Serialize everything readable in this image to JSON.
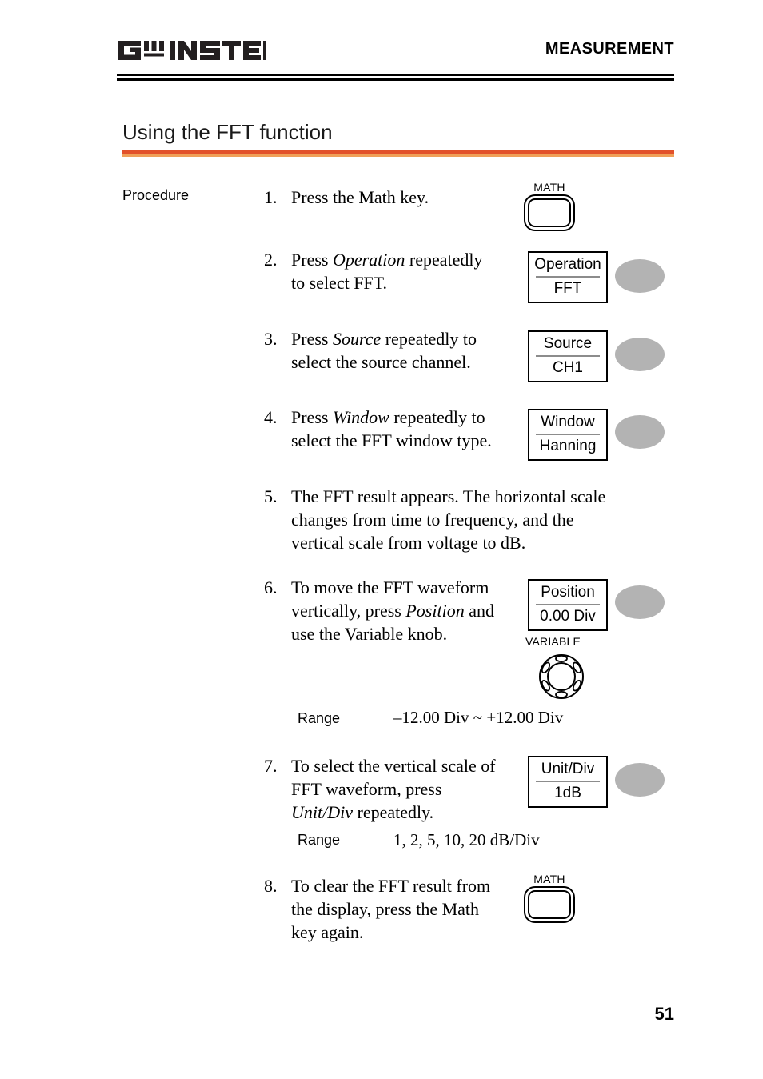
{
  "header": {
    "logo_text": "GW INSTEK",
    "chapter_title": "MEASUREMENT"
  },
  "section": {
    "title": "Using the FFT function"
  },
  "procedure": {
    "label": "Procedure"
  },
  "steps": [
    {
      "number": "1.",
      "text_html": "Press the Math key."
    },
    {
      "number": "2.",
      "text_html": "Press <i>Operation</i> repeatedly<br>to select FFT."
    },
    {
      "number": "3.",
      "text_html": "Press <i>Source</i> repeatedly to<br>select the source channel."
    },
    {
      "number": "4.",
      "text_html": "Press <i>Window</i> repeatedly to<br>select the FFT window type."
    },
    {
      "number": "5.",
      "text_html": "The FFT result appears. The horizontal scale<br>changes from time to frequency, and the<br>vertical scale from voltage to dB."
    },
    {
      "number": "6.",
      "text_html": "To move the FFT waveform<br>vertically, press <i>Position</i> and<br>use the Variable knob."
    },
    {
      "number": "7.",
      "text_html": "To select the vertical scale of<br>FFT waveform, press<br><i>Unit/Div</i> repeatedly."
    },
    {
      "number": "8.",
      "text_html": "To clear the FFT result from<br>the display, press the Math<br>key again."
    }
  ],
  "softkeys": [
    {
      "name": "operation",
      "top_label": "Operation",
      "bottom_value": "FFT"
    },
    {
      "name": "source",
      "top_label": "Source",
      "bottom_value": "CH1"
    },
    {
      "name": "window",
      "top_label": "Window",
      "bottom_value": "Hanning"
    },
    {
      "name": "position",
      "top_label": "Position",
      "bottom_value": "0.00 Div"
    },
    {
      "name": "unit-div",
      "top_label": "Unit/Div",
      "bottom_value": "1dB"
    }
  ],
  "hardkeys": {
    "math_label": "MATH"
  },
  "knob": {
    "label": "VARIABLE"
  },
  "ranges": [
    {
      "label": "Range",
      "value": "–12.00 Div ~ +12.00 Div"
    },
    {
      "label": "Range",
      "value": "1, 2, 5, 10, 20 dB/Div"
    }
  ],
  "footer": {
    "page_number": "51"
  },
  "colors": {
    "rule_dark_orange": "#e2512a",
    "rule_light_orange": "#f0a058",
    "softkey_ellipse_gray": "#b3b3b3",
    "softkey_divider_gray": "#8c8c8c"
  }
}
